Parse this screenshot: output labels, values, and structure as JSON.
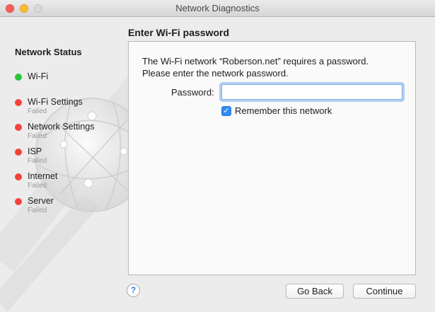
{
  "window": {
    "title": "Network Diagnostics"
  },
  "sidebar": {
    "heading": "Network Status",
    "items": [
      {
        "label": "Wi-Fi",
        "status": "",
        "color": "#2cc43b"
      },
      {
        "label": "Wi-Fi Settings",
        "status": "Failed",
        "color": "#f5443d"
      },
      {
        "label": "Network Settings",
        "status": "Failed",
        "color": "#f5443d"
      },
      {
        "label": "ISP",
        "status": "Failed",
        "color": "#f5443d"
      },
      {
        "label": "Internet",
        "status": "Failed",
        "color": "#f5443d"
      },
      {
        "label": "Server",
        "status": "Failed",
        "color": "#f5443d"
      }
    ]
  },
  "content": {
    "heading": "Enter Wi-Fi password",
    "message_line1": "The Wi-Fi network “Roberson.net” requires a password.",
    "message_line2": "Please enter the network password.",
    "password_label": "Password:",
    "password_value": "",
    "remember_label": "Remember this network",
    "remember_checked": true
  },
  "footer": {
    "help_label": "?",
    "back_label": "Go Back",
    "continue_label": "Continue"
  }
}
